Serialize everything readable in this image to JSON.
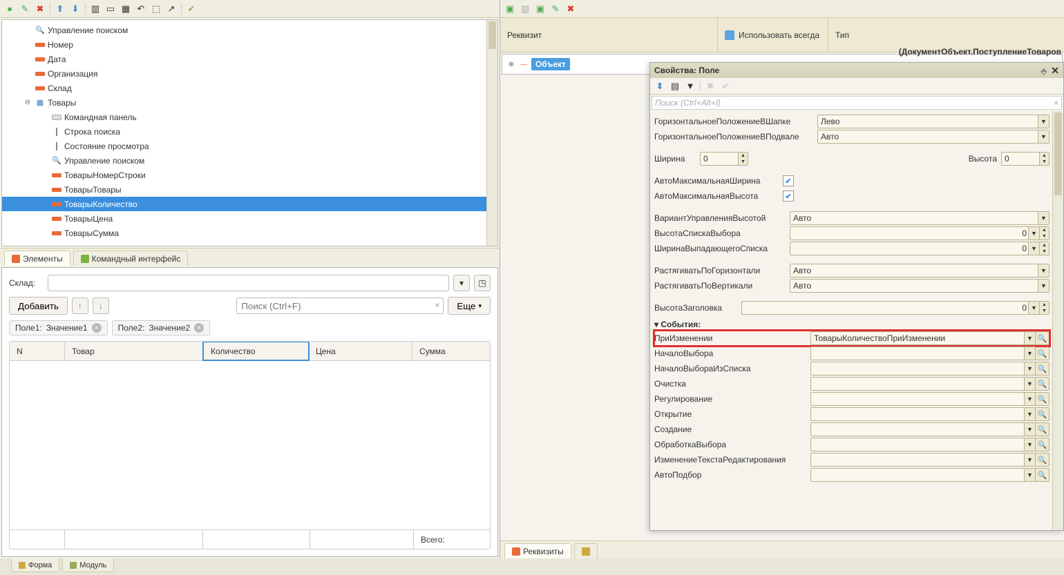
{
  "left": {
    "tree": [
      {
        "icon": "mag",
        "label": "Управление поиском",
        "ind": 24
      },
      {
        "icon": "fld",
        "label": "Номер",
        "ind": 24
      },
      {
        "icon": "fld",
        "label": "Дата",
        "ind": 24
      },
      {
        "icon": "fld",
        "label": "Организация",
        "ind": 24
      },
      {
        "icon": "fld",
        "label": "Склад",
        "ind": 24
      },
      {
        "icon": "tbl",
        "label": "Товары",
        "ind": 24,
        "exp": "-"
      },
      {
        "icon": "cmd",
        "label": "Командная панель",
        "ind": 48
      },
      {
        "icon": "bar",
        "label": "Строка поиска",
        "ind": 48
      },
      {
        "icon": "bar",
        "label": "Состояние просмотра",
        "ind": 48
      },
      {
        "icon": "mag",
        "label": "Управление поиском",
        "ind": 48
      },
      {
        "icon": "fld",
        "label": "ТоварыНомерСтроки",
        "ind": 48
      },
      {
        "icon": "fld",
        "label": "ТоварыТовары",
        "ind": 48
      },
      {
        "icon": "fld",
        "label": "ТоварыКоличество",
        "ind": 48,
        "sel": true
      },
      {
        "icon": "fld",
        "label": "ТоварыЦена",
        "ind": 48
      },
      {
        "icon": "fld",
        "label": "ТоварыСумма",
        "ind": 48
      }
    ],
    "tabs": {
      "elements": "Элементы",
      "cmdui": "Командный интерфейс"
    }
  },
  "preview": {
    "sklad_label": "Склад:",
    "add": "Добавить",
    "more": "Еще",
    "search_ph": "Поиск (Ctrl+F)",
    "chip1_f": "Поле1:",
    "chip1_v": "Значение1",
    "chip2_f": "Поле2:",
    "chip2_v": "Значение2",
    "cols": {
      "n": "N",
      "tovar": "Товар",
      "kol": "Количество",
      "cena": "Цена",
      "summa": "Сумма"
    },
    "total": "Всего:"
  },
  "bottom_tabs": {
    "form": "Форма",
    "module": "Модуль"
  },
  "right": {
    "head": {
      "rekvizit": "Реквизит",
      "use": "Использовать всегда",
      "type": "Тип"
    },
    "object": "Объект",
    "doctype": "(ДокументОбъект.ПоступлениеТоваров",
    "tabs": {
      "rekvizity": "Реквизиты"
    }
  },
  "props": {
    "title": "Свойства: Поле",
    "search_ph": "Поиск (Ctrl+Alt+I)",
    "rows": {
      "hpos_head": {
        "l": "ГоризонтальноеПоложениеВШапке",
        "v": "Лево"
      },
      "hpos_foot": {
        "l": "ГоризонтальноеПоложениеВПодвале",
        "v": "Авто"
      },
      "width": {
        "l": "Ширина",
        "v": "0"
      },
      "height": {
        "l": "Высота",
        "v": "0"
      },
      "automaxw": {
        "l": "АвтоМаксимальнаяШирина"
      },
      "automaxh": {
        "l": "АвтоМаксимальнаяВысота"
      },
      "hvar": {
        "l": "ВариантУправленияВысотой",
        "v": "Авто"
      },
      "listh": {
        "l": "ВысотаСпискаВыбора",
        "v": "0"
      },
      "ddw": {
        "l": "ШиринаВыпадающегоСписка",
        "v": "0"
      },
      "stretchh": {
        "l": "РастягиватьПоГоризонтали",
        "v": "Авто"
      },
      "stretchv": {
        "l": "РастягиватьПоВертикали",
        "v": "Авто"
      },
      "titleh": {
        "l": "ВысотаЗаголовка",
        "v": "0"
      }
    },
    "events_title": "События:",
    "events": [
      {
        "l": "ПриИзменении",
        "v": "ТоварыКоличествоПриИзменении",
        "hl": true
      },
      {
        "l": "НачалоВыбора",
        "v": ""
      },
      {
        "l": "НачалоВыбораИзСписка",
        "v": ""
      },
      {
        "l": "Очистка",
        "v": ""
      },
      {
        "l": "Регулирование",
        "v": ""
      },
      {
        "l": "Открытие",
        "v": ""
      },
      {
        "l": "Создание",
        "v": ""
      },
      {
        "l": "ОбработкаВыбора",
        "v": ""
      },
      {
        "l": "ИзменениеТекстаРедактирования",
        "v": ""
      },
      {
        "l": "АвтоПодбор",
        "v": ""
      }
    ]
  }
}
